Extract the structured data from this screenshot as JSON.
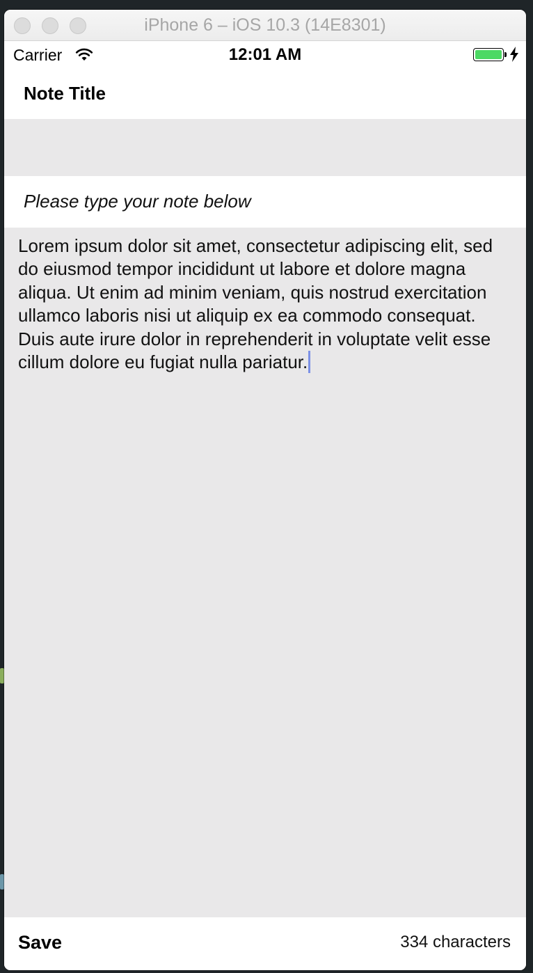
{
  "window": {
    "title": "iPhone 6 – iOS 10.3 (14E8301)"
  },
  "status_bar": {
    "carrier": "Carrier",
    "time": "12:01 AM",
    "battery_color": "#4cd964"
  },
  "header": {
    "title": "Note Title"
  },
  "title_input": {
    "value": ""
  },
  "prompt": {
    "text": "Please type your note below"
  },
  "note": {
    "text": "Lorem ipsum dolor sit amet, consectetur adipiscing elit, sed do eiusmod tempor incididunt ut labore et dolore magna aliqua. Ut enim ad minim veniam, quis nostrud exercitation ullamco laboris nisi ut aliquip ex ea commodo consequat. Duis aute irure dolor in reprehenderit in voluptate velit esse cillum dolore eu fugiat nulla pariatur."
  },
  "toolbar": {
    "save_label": "Save",
    "char_count": "334 characters"
  },
  "colors": {
    "background": "#e9e8e9",
    "caret": "#7c91e6"
  }
}
